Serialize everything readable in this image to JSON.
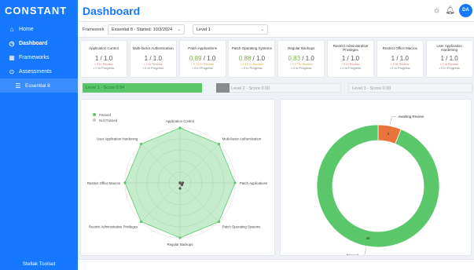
{
  "brand": "CONSTANT",
  "page_title": "Dashboard",
  "sidebar": {
    "items": [
      {
        "label": "Home",
        "icon": "home-icon"
      },
      {
        "label": "Dashboard",
        "icon": "dashboard-icon"
      },
      {
        "label": "Frameworks",
        "icon": "grid-icon"
      },
      {
        "label": "Assessments",
        "icon": "check-circle-icon"
      }
    ],
    "sub_item": {
      "label": "Essential 8",
      "icon": "list-icon"
    },
    "footer": "Stellak Toolset"
  },
  "header": {
    "avatar_initials": "DA"
  },
  "filters": {
    "framework_label": "Framework",
    "framework_value": "Essential 8 - Started: 10/3/2024",
    "level_value": "Level 1"
  },
  "cards": [
    {
      "title": "Application Control",
      "score": "1",
      "total": "1.0",
      "status": "ok",
      "in_review": "0 In Review",
      "in_progress": "0 In Progress"
    },
    {
      "title": "Multi-factor Authentication",
      "score": "1",
      "total": "1.0",
      "status": "ok",
      "in_review": "0 In Review",
      "in_progress": "0 In Progress"
    },
    {
      "title": "Patch Applications",
      "score": "0.89",
      "total": "1.0",
      "status": "warn",
      "in_review": "0.11 In Review",
      "in_progress": "0 In Progress"
    },
    {
      "title": "Patch Operating Systems",
      "score": "0.88",
      "total": "1.0",
      "status": "warn",
      "in_review": "0.13 In Review",
      "in_progress": "0 In Progress"
    },
    {
      "title": "Regular Backups",
      "score": "0.83",
      "total": "1.0",
      "status": "warn",
      "in_review": "0.17 In Review",
      "in_progress": "0 In Progress"
    },
    {
      "title": "Restrict Administrative Privileges",
      "score": "1",
      "total": "1.0",
      "status": "ok",
      "in_review": "0 In Review",
      "in_progress": "0 In Progress"
    },
    {
      "title": "Restrict Office Macros",
      "score": "1",
      "total": "1.0",
      "status": "ok",
      "in_review": "0 In Review",
      "in_progress": "0 In Progress"
    },
    {
      "title": "User Application Hardening",
      "score": "1",
      "total": "1.0",
      "status": "ok",
      "in_review": "0 In Review",
      "in_progress": "0 In Progress"
    }
  ],
  "levels": {
    "level1": "Level 1 - Score 0.94",
    "level2": "Level 2 - Score 0.00",
    "level3": "Level 3 - Score 0.00"
  },
  "colors": {
    "accent": "#1677ff",
    "passed": "#5ac86a",
    "review": "#e8743b",
    "not_passed": "#c7c7c7"
  },
  "chart_data": [
    {
      "type": "radar",
      "legend": [
        "Passed",
        "Not Passed"
      ],
      "legend_position": "top-left",
      "categories": [
        "Application Control",
        "Multi-factor Authentication",
        "Patch Applications",
        "Patch Operating Systems",
        "Regular Backups",
        "Restrict Administrative Privileges",
        "Restrict Office Macros",
        "User Application Hardening"
      ],
      "series": [
        {
          "name": "Passed",
          "values": [
            1,
            1,
            1,
            1,
            1,
            1,
            1,
            1
          ]
        },
        {
          "name": "Not Passed",
          "values": [
            0,
            0,
            0.05,
            0.05,
            0.1,
            0,
            0,
            0
          ]
        }
      ],
      "rlim": [
        0,
        1
      ]
    },
    {
      "type": "pie",
      "donut": true,
      "slices": [
        {
          "label": "Passed",
          "value": 46,
          "color": "#5ac86a"
        },
        {
          "label": "Awaiting Review",
          "value": 3,
          "color": "#e8743b"
        }
      ]
    }
  ]
}
